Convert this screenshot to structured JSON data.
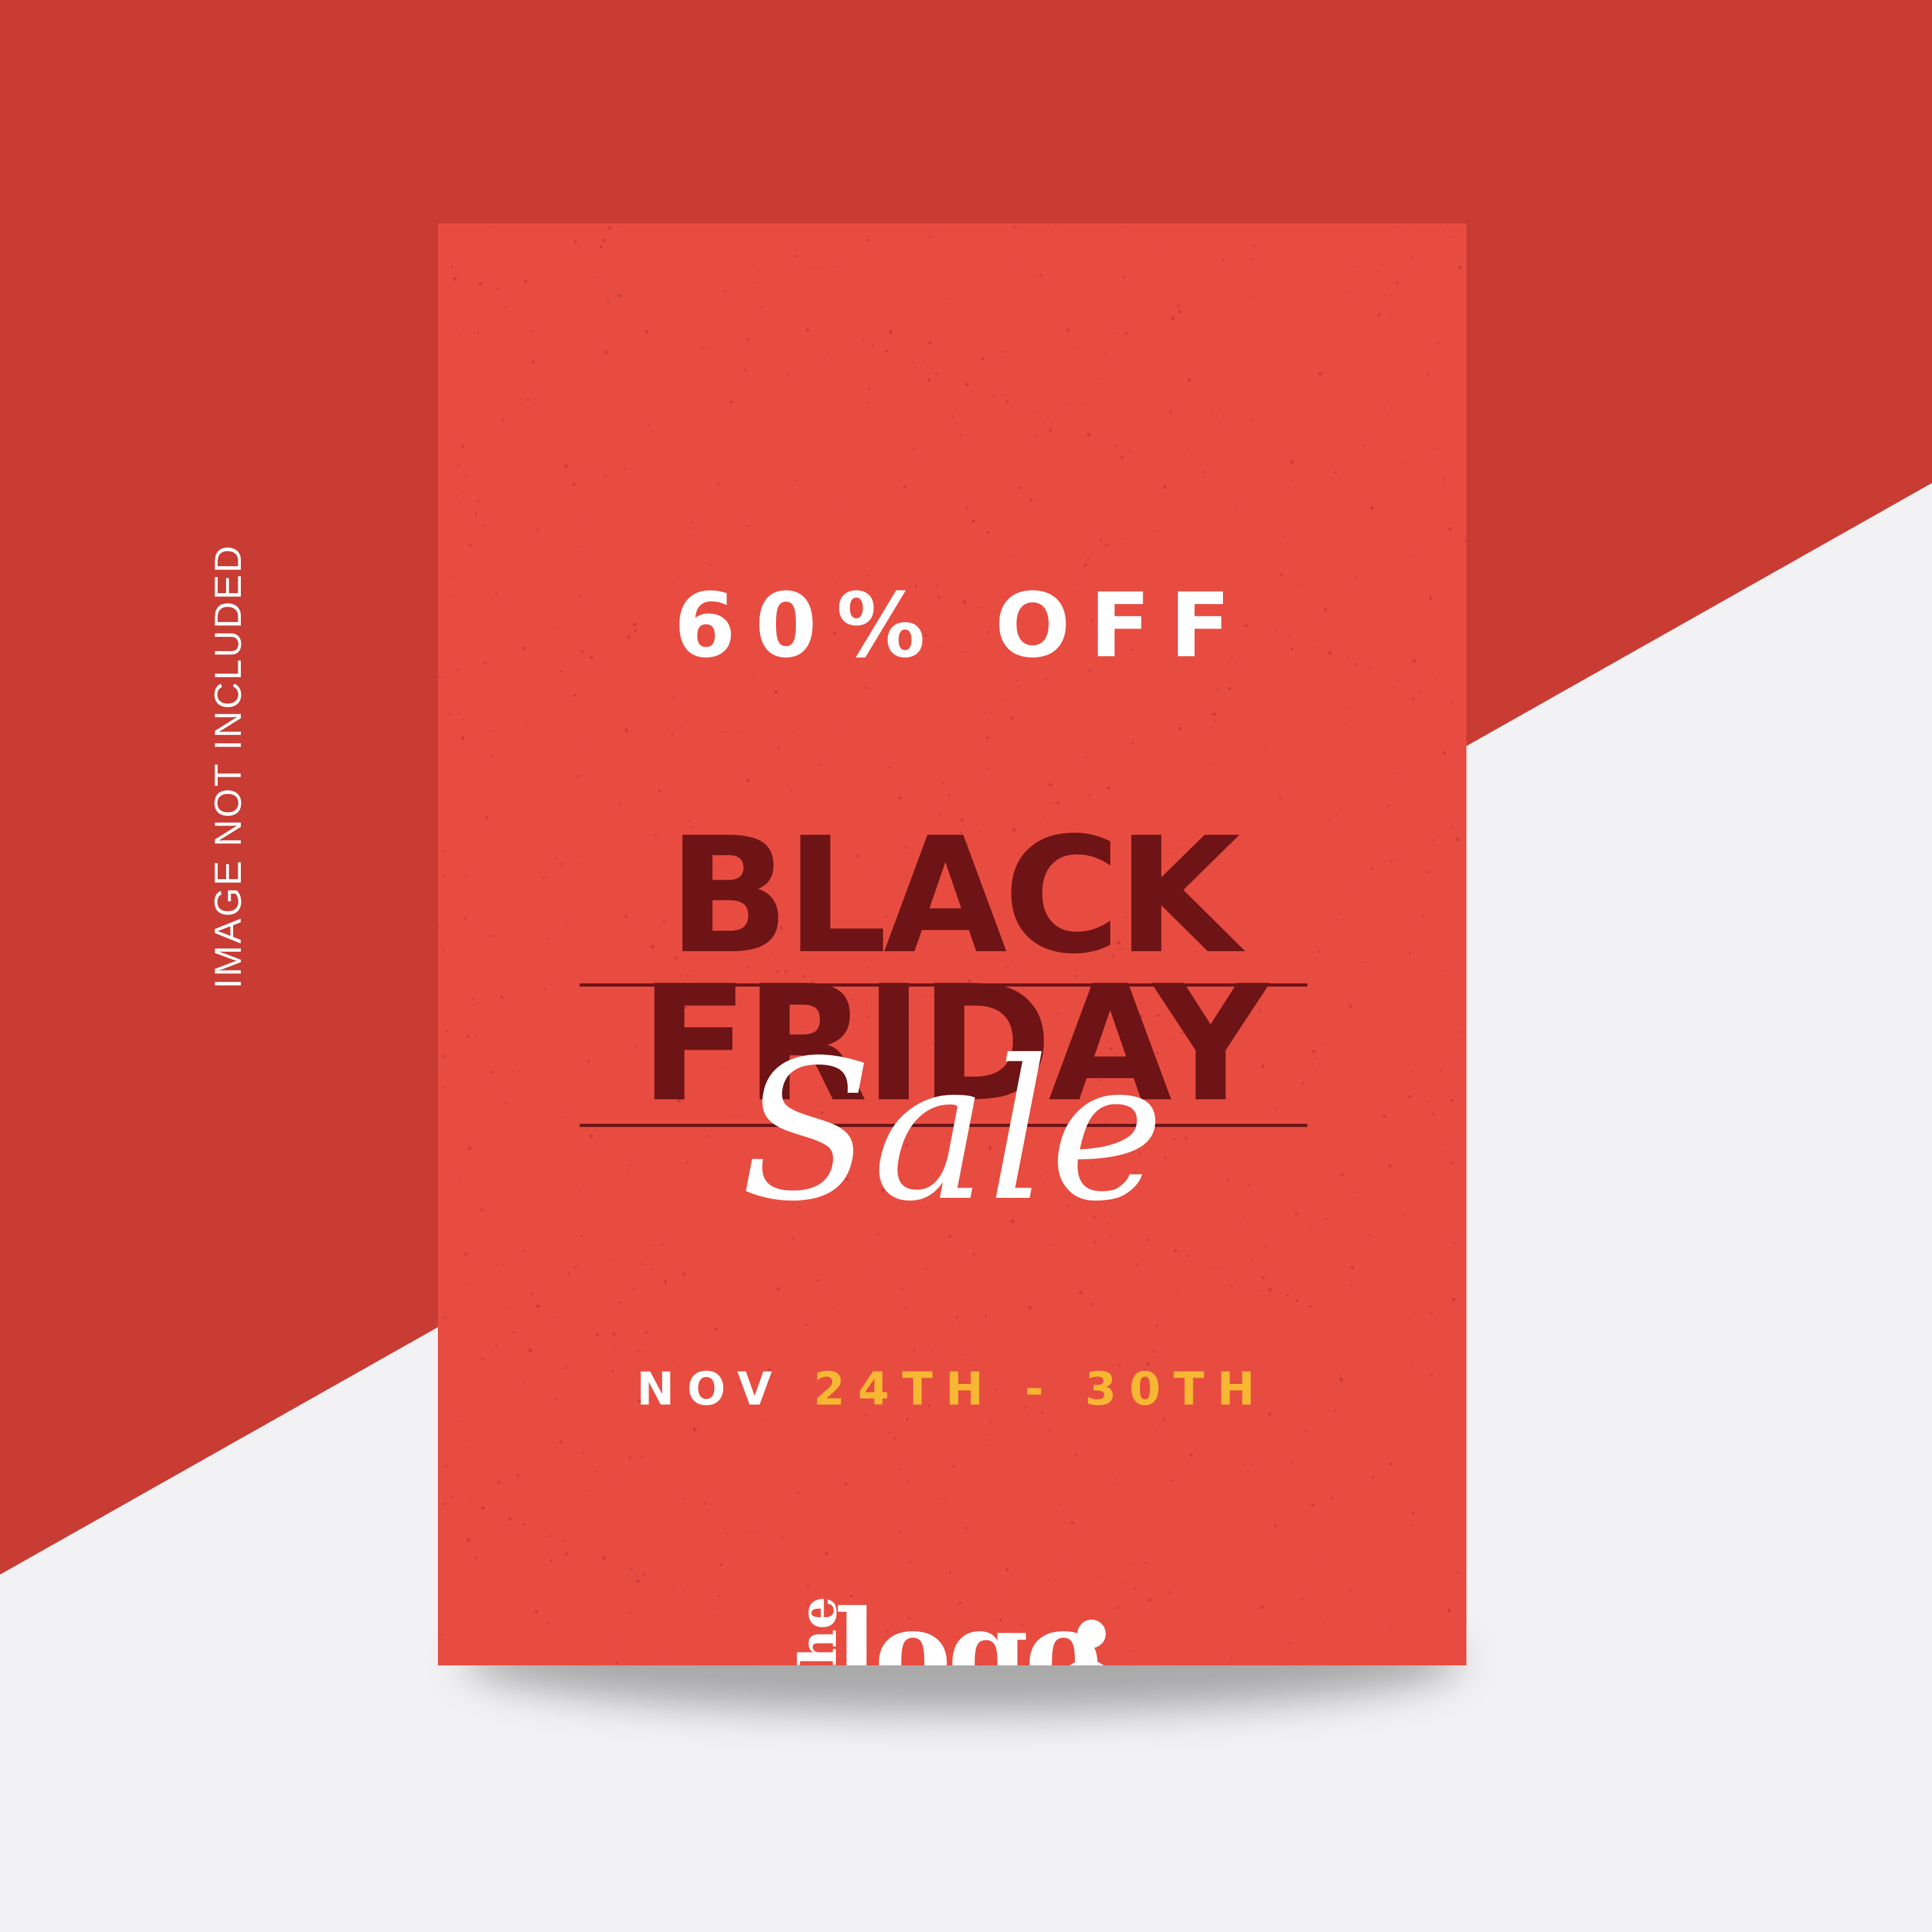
{
  "background": {
    "colors": {
      "panel": "#c83c34",
      "page": "#f2f2f4"
    }
  },
  "side_note": {
    "text": "IMAGE NOT INCLUDED"
  },
  "poster": {
    "colors": {
      "paper": "#e84c40",
      "headline": "#6e1416",
      "text": "#ffffff",
      "accent": "#f7b733"
    },
    "discount": "60% OFF",
    "headline": {
      "line1": "BLACK",
      "line2": "FRIDAY"
    },
    "script": "Sale",
    "dates": {
      "month": "NOV",
      "range": "24TH - 30TH"
    },
    "logo": {
      "small": "the",
      "word": "logo"
    }
  }
}
